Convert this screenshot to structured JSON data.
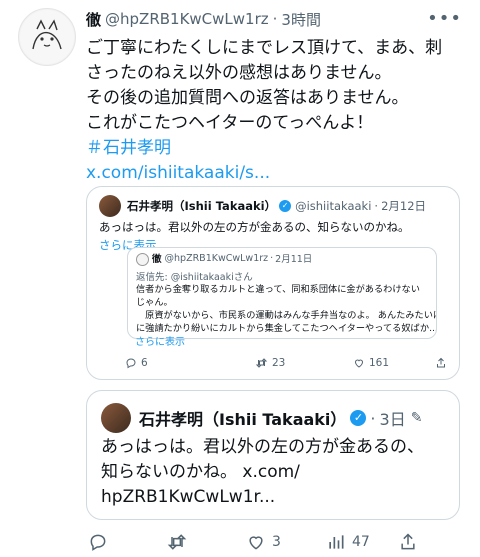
{
  "post": {
    "name": "徹",
    "handle": "@hpZRB1KwCwLw1rz",
    "dot": "·",
    "time": "3時間",
    "body_lines": [
      "ご丁寧にわたくしにまでレス頂けて、まあ、刺",
      "さったのねえ以外の感想はありません。",
      "その後の追加質問への返答はありません。",
      "これがこたつヘイターのてっぺんよ！"
    ],
    "hashtag": "＃石井孝明",
    "link": "x.com/ishiitakaaki/s..."
  },
  "quote1": {
    "name": "石井孝明（Ishii Takaaki）",
    "handle": "@ishiitakaaki",
    "dot": "·",
    "date": "2月12日",
    "text": "あっはっは。君以外の左の方が金あるの、知らないのかね。",
    "show_more": "さらに表示",
    "stats": {
      "replies": "6",
      "reposts": "23",
      "likes": "161"
    }
  },
  "quote2": {
    "name": "徹",
    "handle": "@hpZRB1KwCwLw1rz",
    "dot": "·",
    "date": "2月11日",
    "reply_to": "返信先: @ishiitakaakiさん",
    "lines": [
      "信者から金奪り取るカルトと違って、同和系団体に金があるわけない",
      "じゃん。",
      "　原資がないから、市民系の運動はみんな手弁当なのよ。 あんたみたいに",
      "に強請たかり紛いにカルトから集金してこたつヘイターやってる奴ばか..."
    ],
    "show_more": "さらに表示"
  },
  "quote3": {
    "name": "石井孝明（Ishii Takaaki）",
    "dot": "·",
    "time": "3日",
    "lines": [
      "あっはっは。君以外の左の方が金あるの、",
      "知らないのかね。 x.com/",
      "hpZRB1KwCwLw1r..."
    ]
  },
  "actions": {
    "replies": "",
    "reposts": "",
    "likes": "3",
    "views": "47"
  },
  "colors": {
    "accent": "#1d9bf0",
    "muted": "#536471",
    "border": "#cfd9de"
  }
}
